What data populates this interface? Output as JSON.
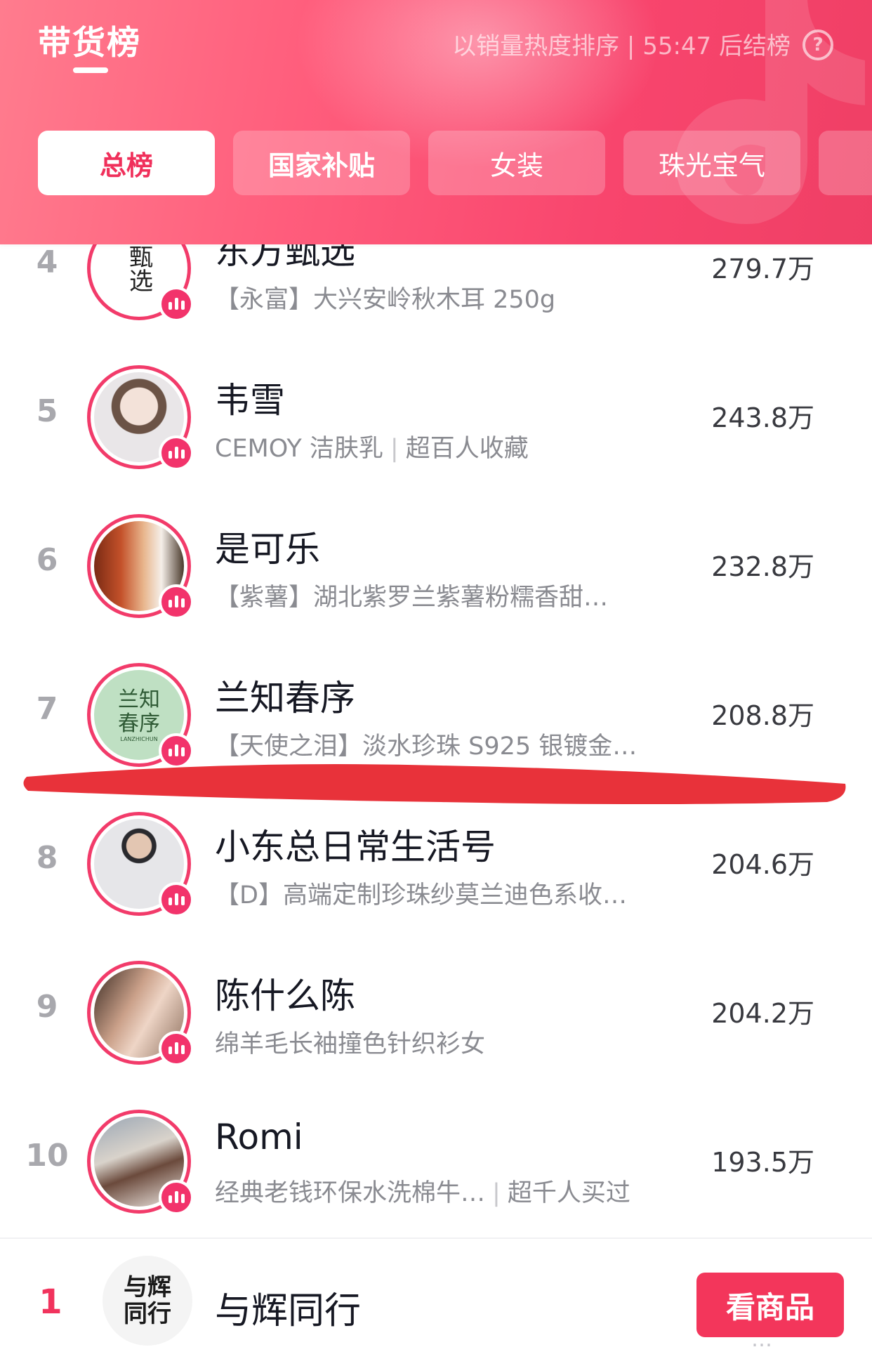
{
  "header": {
    "title": "带货榜",
    "info": "以销量热度排序 | 55:47 后结榜",
    "help_icon": "?",
    "tabs": [
      {
        "label": "总榜",
        "active": true
      },
      {
        "label": "国家补贴",
        "active": false
      },
      {
        "label": "女装",
        "active": false
      },
      {
        "label": "珠光宝气",
        "active": false
      }
    ]
  },
  "list": [
    {
      "rank": "4",
      "name": "东方甄选",
      "sub": "【永富】大兴安岭秋木耳 250g",
      "sub_extra": "",
      "score": "279.7万"
    },
    {
      "rank": "5",
      "name": "韦雪",
      "sub": "CEMOY 洁肤乳",
      "sub_extra": "超百人收藏",
      "score": "243.8万"
    },
    {
      "rank": "6",
      "name": "是可乐",
      "sub": "【紫薯】湖北紫罗兰紫薯粉糯香甜…",
      "sub_extra": "",
      "score": "232.8万"
    },
    {
      "rank": "7",
      "name": "兰知春序",
      "sub": "【天使之泪】淡水珍珠 S925 银镀金…",
      "sub_extra": "",
      "score": "208.8万"
    },
    {
      "rank": "8",
      "name": "小东总日常生活号",
      "sub": "【D】高端定制珍珠纱莫兰迪色系收…",
      "sub_extra": "",
      "score": "204.6万"
    },
    {
      "rank": "9",
      "name": "陈什么陈",
      "sub": "绵羊毛长袖撞色针织衫女",
      "sub_extra": "",
      "score": "204.2万"
    },
    {
      "rank": "10",
      "name": "Romi",
      "sub": "经典老钱环保水洗棉牛…",
      "sub_extra": "超千人买过",
      "score": "193.5万"
    }
  ],
  "avatar_text": {
    "row4": "甄选",
    "row7": "兰知春序",
    "row7_small": "LANZHICHUN",
    "bottom": "与辉同行"
  },
  "bottom": {
    "rank": "1",
    "name": "与辉同行",
    "button": "看商品"
  },
  "watermark": "…",
  "colors": {
    "accent": "#f0305b",
    "header_gradient": [
      "#ff7c8e",
      "#ef3f65"
    ],
    "marker": "#e8323a",
    "score_text": "#38393f",
    "rank_gray": "#a8a8ad"
  }
}
